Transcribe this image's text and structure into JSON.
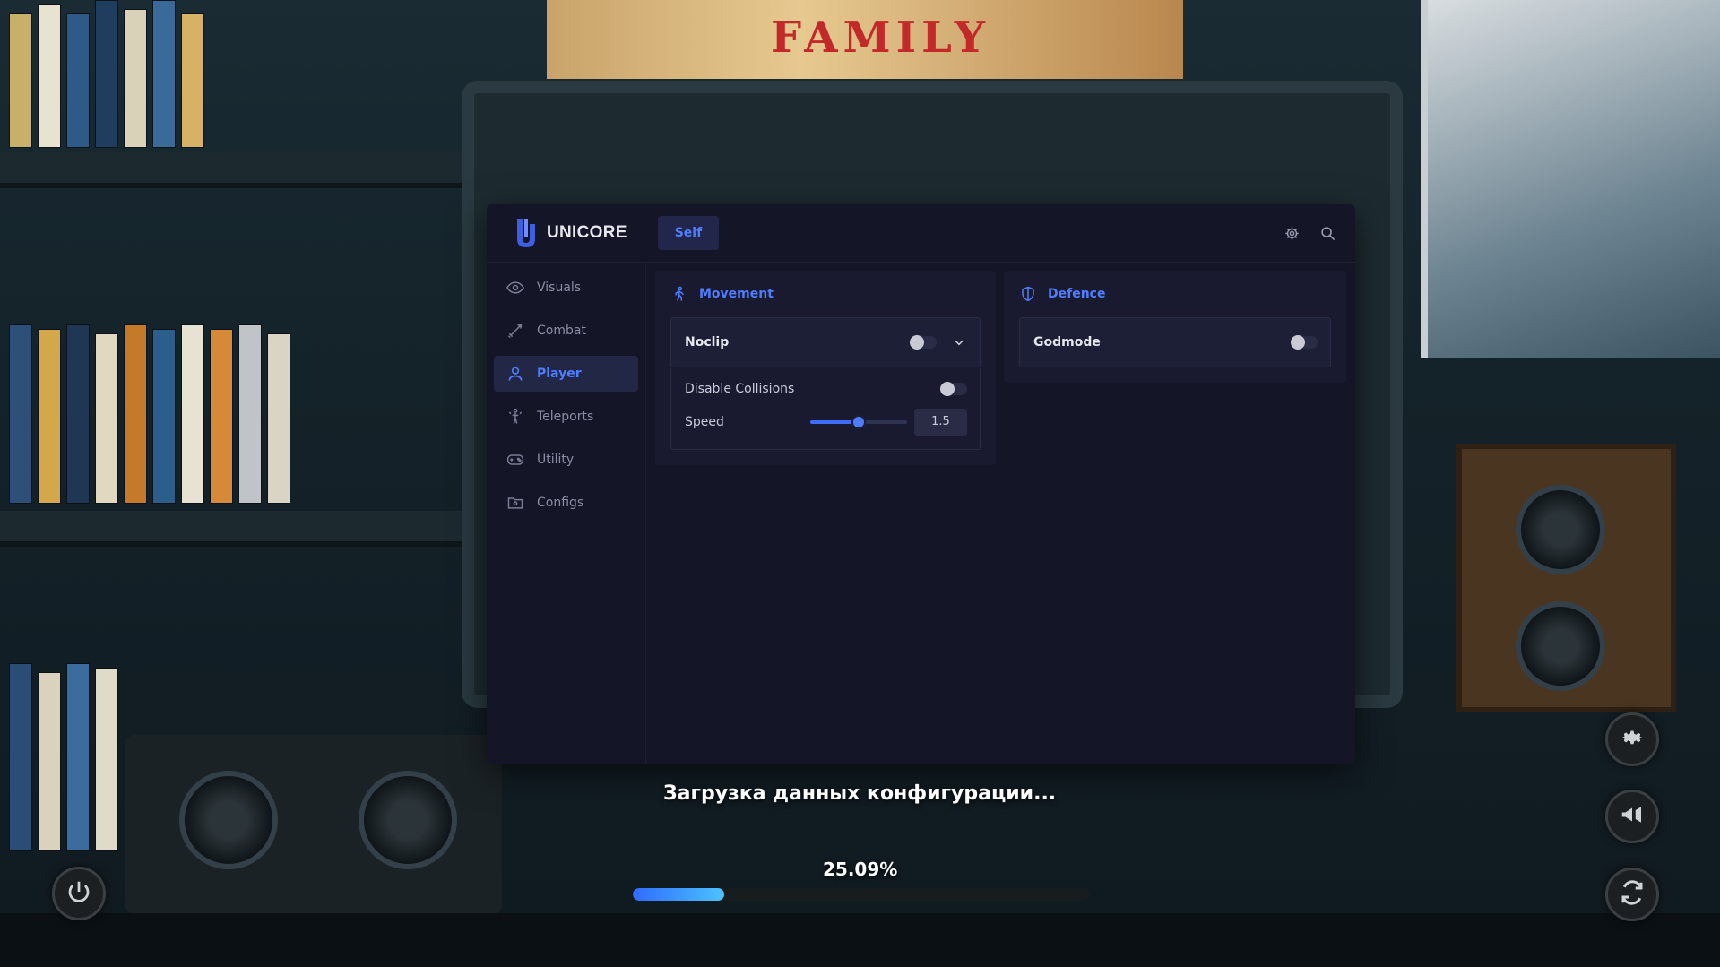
{
  "app": {
    "brand_name": "UNICORE",
    "tab_self": "Self",
    "accent_color": "#4f7dff"
  },
  "header": {
    "icons": [
      "gear-icon",
      "search-icon"
    ]
  },
  "sidebar": {
    "items": [
      {
        "label": "Visuals",
        "icon": "eye-icon",
        "active": false
      },
      {
        "label": "Combat",
        "icon": "sword-icon",
        "active": false
      },
      {
        "label": "Player",
        "icon": "user-icon",
        "active": true
      },
      {
        "label": "Teleports",
        "icon": "teleport-icon",
        "active": false
      },
      {
        "label": "Utility",
        "icon": "gamepad-icon",
        "active": false
      },
      {
        "label": "Configs",
        "icon": "folder-icon",
        "active": false
      }
    ]
  },
  "movement": {
    "title": "Movement",
    "icon": "walking-icon",
    "noclip": {
      "label": "Noclip",
      "enabled": false
    },
    "disable_collisions": {
      "label": "Disable Collisions",
      "enabled": false
    },
    "speed": {
      "label": "Speed",
      "value": "1.5",
      "fill_fraction": 0.5
    }
  },
  "defence": {
    "title": "Defence",
    "icon": "shield-icon",
    "godmode": {
      "label": "Godmode",
      "enabled": false
    }
  },
  "loading": {
    "text": "Загрузка данных конфигурации...",
    "percent_text": "25.09%",
    "progress_fraction": 0.2009
  },
  "corner_buttons": [
    "power-icon",
    "settings-icon",
    "megaphone-icon",
    "refresh-icon"
  ],
  "background": {
    "poster_text": "FAMILY"
  }
}
